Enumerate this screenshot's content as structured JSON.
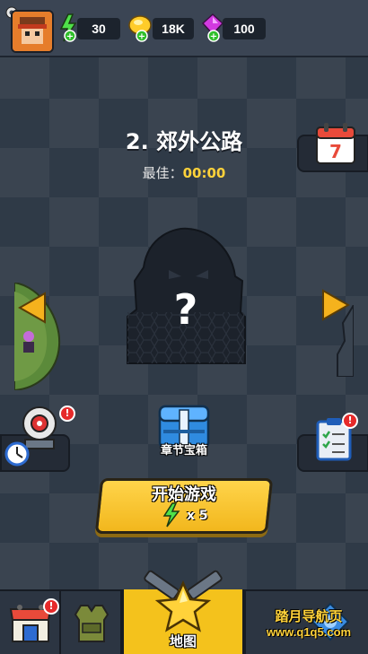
{
  "resources": {
    "energy": "30",
    "gold": "18K",
    "gems": "100"
  },
  "level": {
    "title": "2. 郊外公路",
    "best_label": "最佳：",
    "best_time": "00:00",
    "boss_mark": "?"
  },
  "chest": {
    "label": "章节宝箱"
  },
  "start": {
    "label": "开始游戏",
    "cost": "x 5"
  },
  "nav": {
    "map_label": "地图"
  },
  "watermark": {
    "line1": "踏月导航页",
    "line2": "www.q1q5.com"
  },
  "badge_mark": "!",
  "calendar_day": "7",
  "colors": {
    "accent_yellow": "#f4c21c",
    "energy_green": "#3ccf3a",
    "gem_purple": "#c23ad8",
    "alert_red": "#e62a2a"
  }
}
